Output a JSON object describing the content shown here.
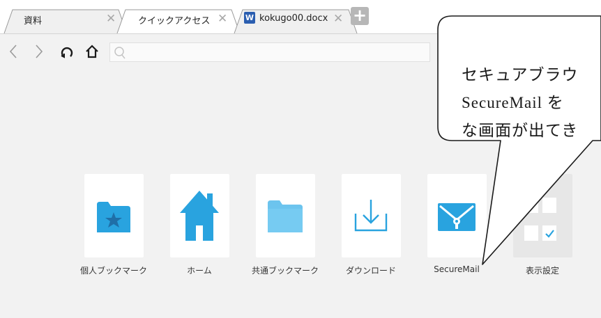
{
  "tabs": [
    {
      "label": "資料",
      "close": "✕"
    },
    {
      "label": "クイックアクセス",
      "close": "✕"
    },
    {
      "label": "kokugo00.docx",
      "close": "✕",
      "icon_letter": "W"
    }
  ],
  "new_tab_label": "+",
  "address_bar": {
    "value": "",
    "placeholder": ""
  },
  "tiles": [
    {
      "label": "個人ブックマーク",
      "icon": "personal-bookmark-folder-icon"
    },
    {
      "label": "ホーム",
      "icon": "home-icon"
    },
    {
      "label": "共通ブックマーク",
      "icon": "shared-bookmark-folder-icon"
    },
    {
      "label": "ダウンロード",
      "icon": "download-icon"
    },
    {
      "label": "SecureMail",
      "icon": "secure-mail-icon"
    },
    {
      "label": "表示設定",
      "icon": "display-settings-icon"
    }
  ],
  "callout": {
    "line1": "セキュアブラウ",
    "line2": "SecureMail を",
    "line3": "な画面が出てき"
  },
  "colors": {
    "accent": "#29a3df",
    "accent_light": "#6cc4ee",
    "tab_active": "#ffffff",
    "tab_inactive": "#f0f0f0",
    "page_bg": "#f2f2f2",
    "tile_bg": "#ffffff"
  }
}
